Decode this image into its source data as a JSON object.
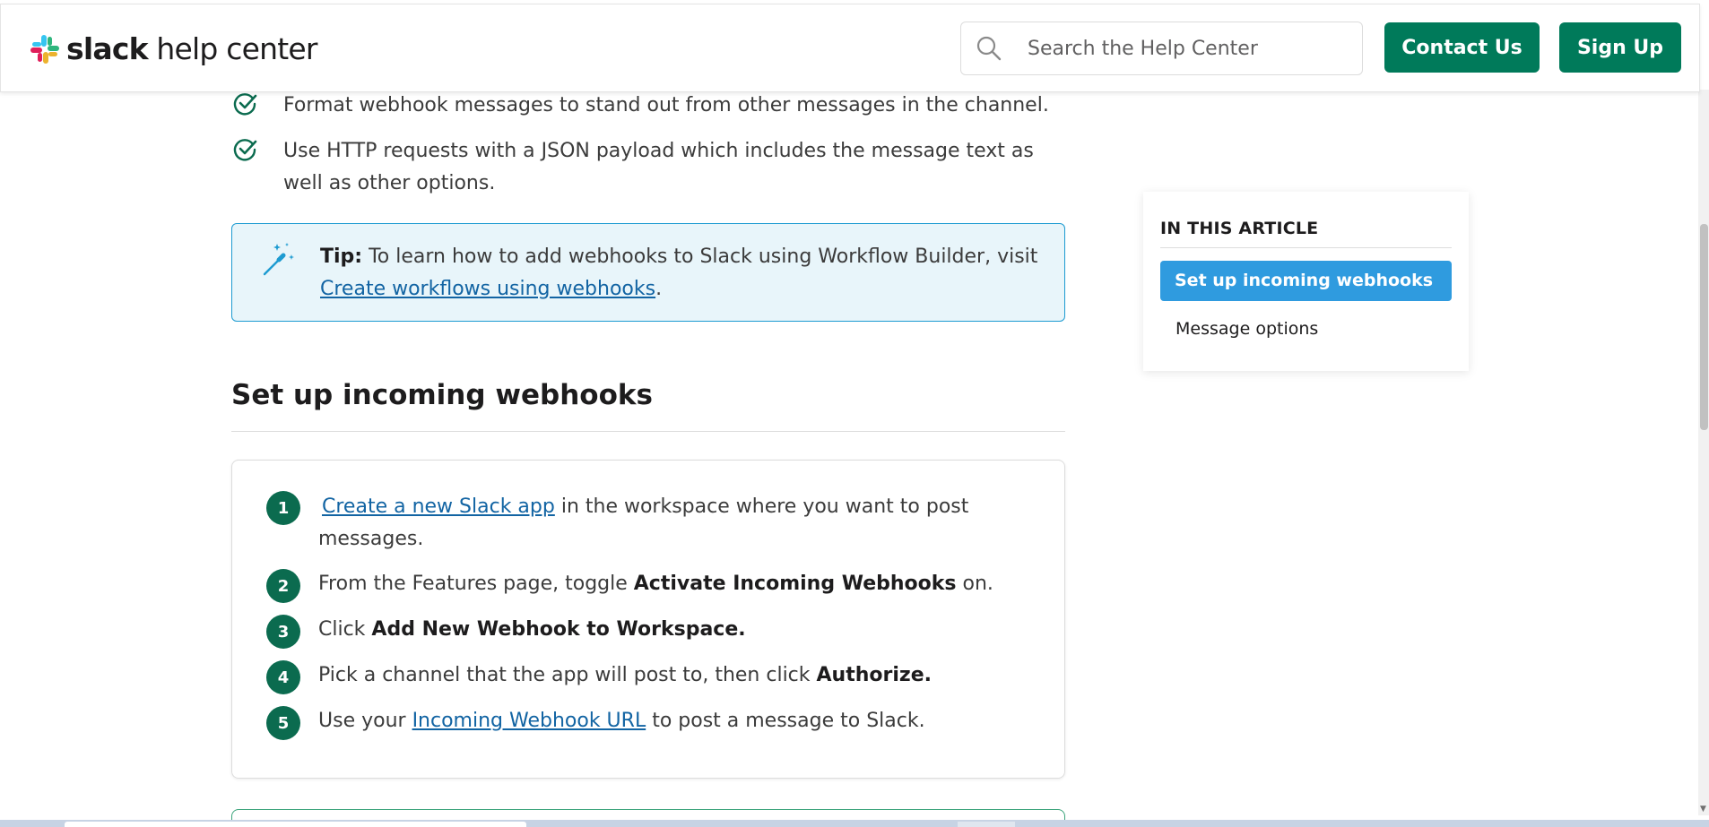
{
  "header": {
    "logo_brand": "slack",
    "logo_suffix": " help center",
    "search_placeholder": "Search the Help Center",
    "contact_label": "Contact Us",
    "signup_label": "Sign Up"
  },
  "intro_checks": [
    "Format webhook messages to stand out from other messages in the channel.",
    "Use HTTP requests with a JSON payload which includes the message text as well as other options."
  ],
  "tip": {
    "label": "Tip:",
    "text": " To learn how to add webhooks to Slack using Workflow Builder, visit ",
    "link": "Create workflows using webhooks",
    "end": "."
  },
  "section": {
    "title": "Set up incoming webhooks"
  },
  "steps": [
    {
      "num": "1",
      "link": "Create a new Slack app",
      "text": " in the workspace where you want to post messages."
    },
    {
      "num": "2",
      "pre": "From the Features page, toggle ",
      "bold": "Activate Incoming Webhooks",
      "post": " on."
    },
    {
      "num": "3",
      "pre": "Click ",
      "bold": "Add New Webhook to Workspace.",
      "post": ""
    },
    {
      "num": "4",
      "pre": "Pick a channel that the app will post to, then click ",
      "bold": "Authorize.",
      "post": ""
    },
    {
      "num": "5",
      "pre": "Use your ",
      "link": "Incoming Webhook URL",
      "post": " to post a message to Slack."
    }
  ],
  "toc": {
    "heading": "IN THIS ARTICLE",
    "items": [
      "Set up incoming webhooks",
      "Message options"
    ],
    "active_index": 0
  },
  "colors": {
    "brand_green": "#007a5a",
    "step_green": "#0b6b4f",
    "link_blue": "#1264a3",
    "toc_active_blue": "#2f9bdf",
    "tip_bg": "#e8f5fa"
  }
}
